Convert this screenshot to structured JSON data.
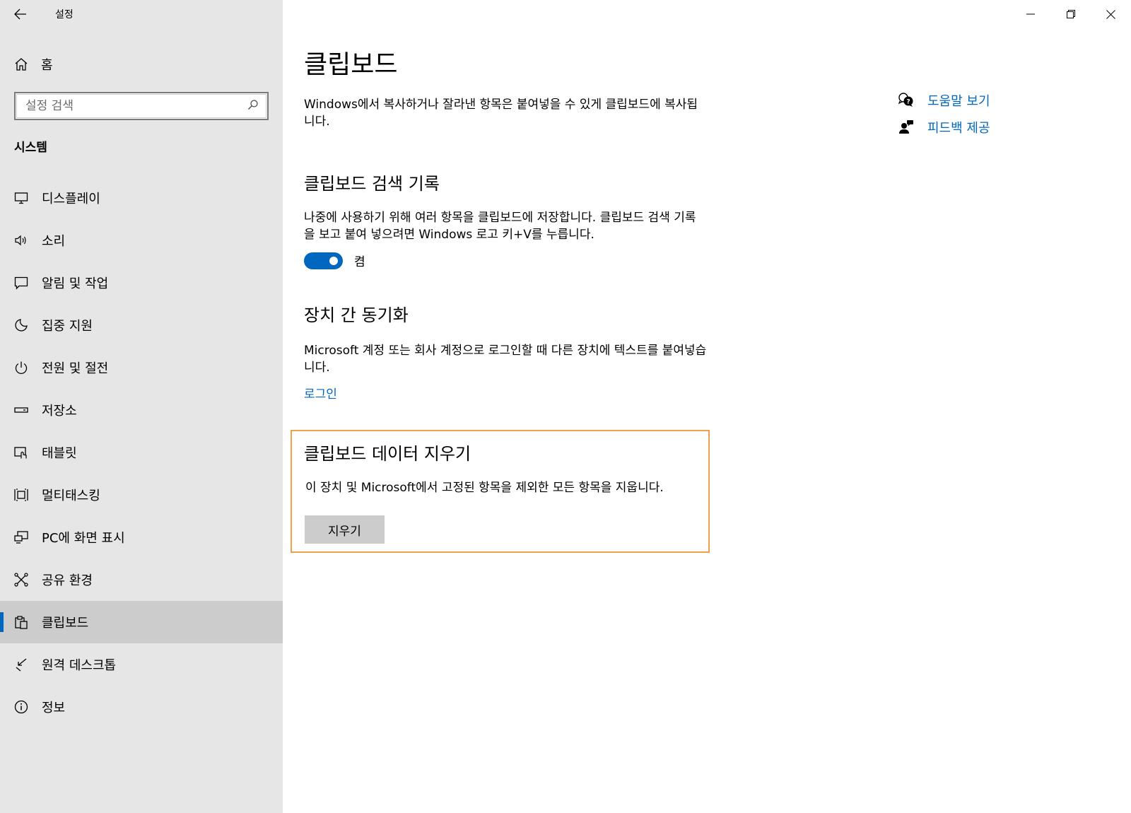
{
  "window": {
    "app_title": "설정",
    "controls": [
      "minimize",
      "restore",
      "close"
    ]
  },
  "sidebar": {
    "home_label": "홈",
    "search_placeholder": "설정 검색",
    "section_title": "시스템",
    "items": [
      {
        "label": "디스플레이",
        "icon": "display-icon"
      },
      {
        "label": "소리",
        "icon": "speaker-icon"
      },
      {
        "label": "알림 및 작업",
        "icon": "notification-icon"
      },
      {
        "label": "집중 지원",
        "icon": "moon-icon"
      },
      {
        "label": "전원 및 절전",
        "icon": "power-icon"
      },
      {
        "label": "저장소",
        "icon": "storage-icon"
      },
      {
        "label": "태블릿",
        "icon": "tablet-icon"
      },
      {
        "label": "멀티태스킹",
        "icon": "multitasking-icon"
      },
      {
        "label": "PC에 화면 표시",
        "icon": "project-icon"
      },
      {
        "label": "공유 환경",
        "icon": "shared-experiences-icon"
      },
      {
        "label": "클립보드",
        "icon": "clipboard-icon",
        "active": true
      },
      {
        "label": "원격 데스크톱",
        "icon": "remote-desktop-icon"
      },
      {
        "label": "정보",
        "icon": "info-icon"
      }
    ]
  },
  "main": {
    "title": "클립보드",
    "intro": "Windows에서 복사하거나 잘라낸 항목은 붙여넣을 수 있게 클립보드에 복사됩니다.",
    "history": {
      "title": "클립보드 검색 기록",
      "description": "나중에 사용하기 위해 여러 항목을 클립보드에 저장합니다. 클립보드 검색 기록을 보고 붙여 넣으려면 Windows 로고 키+V를 누릅니다.",
      "toggle_state": "켬"
    },
    "sync": {
      "title": "장치 간 동기화",
      "description": "Microsoft 계정 또는 회사 계정으로 로그인할 때 다른 장치에 텍스트를 붙여넣습니다.",
      "link": "로그인"
    },
    "clear": {
      "title": "클립보드 데이터 지우기",
      "description": "이 장치 및 Microsoft에서 고정된 항목을 제외한 모든 항목을 지웁니다.",
      "button": "지우기"
    }
  },
  "help": {
    "get_help": "도움말 보기",
    "feedback": "피드백 제공"
  },
  "colors": {
    "accent": "#0067c0",
    "sidebar_bg": "#e6e6e6",
    "highlight_border": "#f0a04b"
  }
}
